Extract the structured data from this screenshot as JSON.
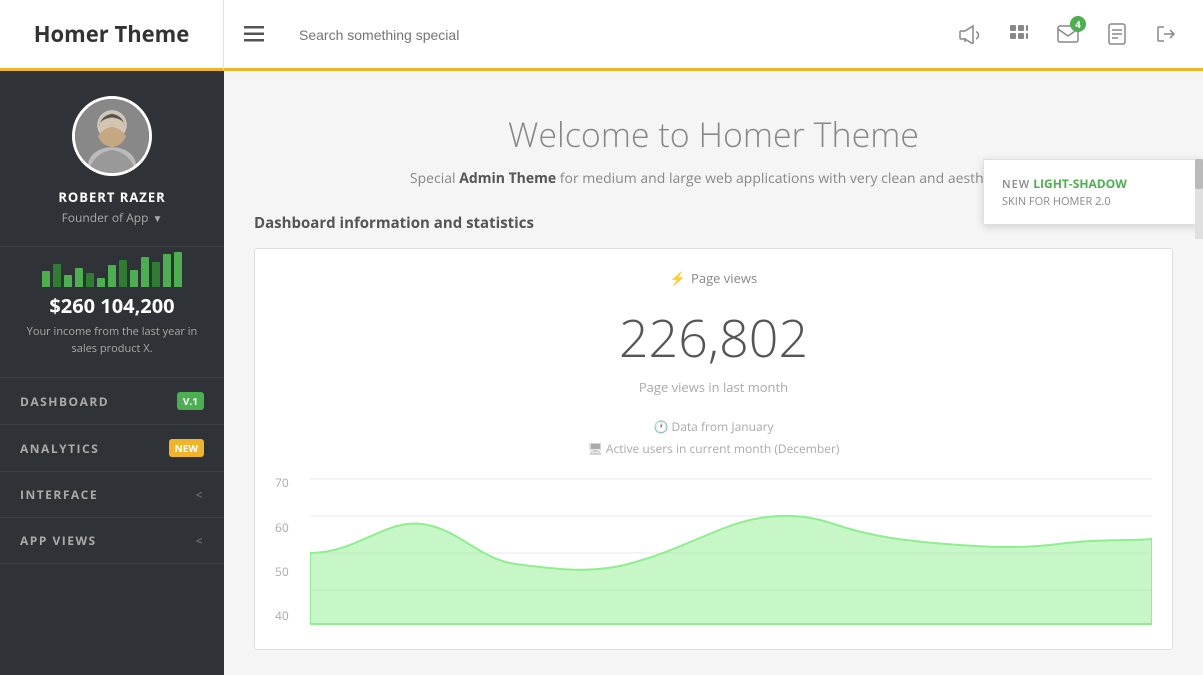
{
  "navbar": {
    "brand": "Homer Theme",
    "search_placeholder": "Search something special",
    "icons": {
      "megaphone": "📣",
      "apps": "⠿",
      "mail": "✉",
      "mail_badge": "4",
      "document": "📄",
      "logout": "⏻"
    }
  },
  "sidebar": {
    "user": {
      "name": "ROBERT RAZER",
      "role": "Founder of App"
    },
    "income": {
      "amount": "$260 104,200",
      "description": "Your income from the last year in sales product X."
    },
    "nav_items": [
      {
        "label": "DASHBOARD",
        "badge": "V.1",
        "badge_type": "green",
        "chevron": ""
      },
      {
        "label": "ANALYTICS",
        "badge": "NEW",
        "badge_type": "orange",
        "chevron": ""
      },
      {
        "label": "INTERFACE",
        "badge": "",
        "badge_type": "",
        "chevron": "<"
      },
      {
        "label": "APP VIEWS",
        "badge": "",
        "badge_type": "",
        "chevron": "<"
      }
    ],
    "chart_bars": [
      20,
      30,
      15,
      25,
      18,
      12,
      28,
      35,
      22,
      38,
      32,
      42,
      45
    ]
  },
  "content": {
    "welcome_title": "Welcome to Homer Theme",
    "welcome_subtitle_pre": "Special ",
    "welcome_subtitle_bold": "Admin Theme",
    "welcome_subtitle_post": " for medium and large web applications with very clean and aesthetic s",
    "section_title": "Dashboard information and statistics",
    "stats": {
      "page_views_label": "Page views",
      "page_views_number": "226,802",
      "page_views_sublabel": "Page views in last month",
      "data_source": "Data from January",
      "active_users": "Active users in current month (December)",
      "y_labels": [
        "70",
        "60",
        "50",
        "40"
      ]
    }
  },
  "popup": {
    "new_label": "NEW",
    "highlight": "LIGHT-SHADOW",
    "skin_text": "SKIN FOR HOMER 2.0"
  }
}
